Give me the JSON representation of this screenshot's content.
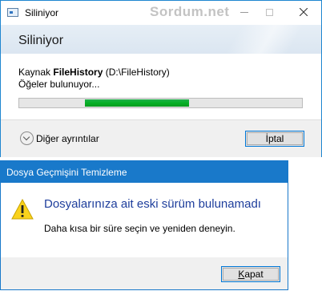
{
  "delete_dialog": {
    "window_title": "Siliniyor",
    "watermark": "Sordum.net",
    "heading": "Siliniyor",
    "source_prefix": "Kaynak",
    "source_name": "FileHistory",
    "source_path": "(D:\\FileHistory)",
    "status": "Öğeler bulunuyor...",
    "progress": {
      "indeterminate": true,
      "fill_color": "#06b025"
    },
    "more_details_label": "Diğer ayrıntılar",
    "cancel_label": "İptal"
  },
  "history_dialog": {
    "window_title": "Dosya Geçmişini Temizleme",
    "icon": "warning-icon",
    "heading": "Dosyalarınıza ait eski sürüm bulunamadı",
    "message": "Daha kısa bir süre seçin ve yeniden deneyin.",
    "close_label_first": "K",
    "close_label_rest": "apat"
  },
  "colors": {
    "titlebar_active": "#1979ca",
    "heading_blue": "#1e3e9c",
    "progress_green": "#06b025"
  }
}
